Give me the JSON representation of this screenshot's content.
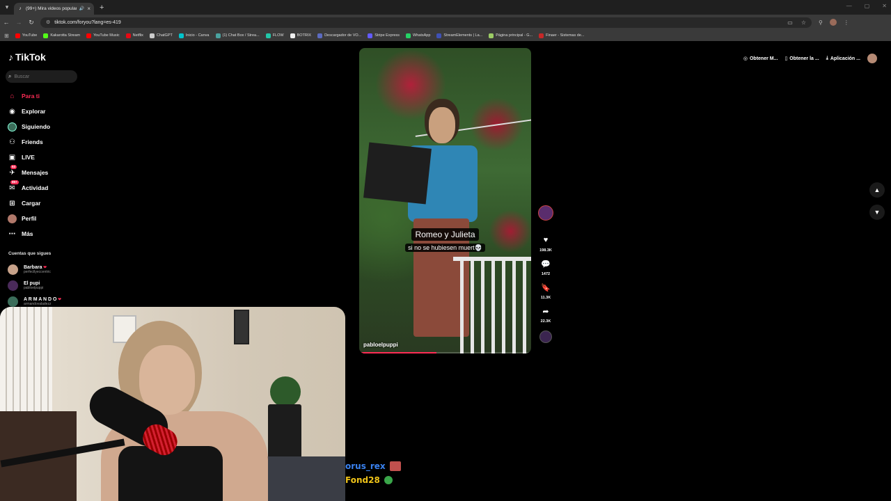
{
  "browser": {
    "tab_title": "(99+) Mira videos populares",
    "url": "tiktok.com/foryou?lang=es-419",
    "bookmarks": [
      {
        "label": "YouTube",
        "color": "#ff0000"
      },
      {
        "label": "Kakarotta Stream",
        "color": "#53fc18"
      },
      {
        "label": "YouTube Music",
        "color": "#ff0000"
      },
      {
        "label": "Netflix",
        "color": "#e50914"
      },
      {
        "label": "ChatGPT",
        "color": "#cccccc"
      },
      {
        "label": "Inicio - Canva",
        "color": "#00c4cc"
      },
      {
        "label": "(1) Chat Box / Strea...",
        "color": "#4aa3a0"
      },
      {
        "label": "FLOW",
        "color": "#22c7a9"
      },
      {
        "label": "BOTRIX",
        "color": "#eeeeee"
      },
      {
        "label": "Descargador de VO...",
        "color": "#5c6bc0"
      },
      {
        "label": "Stripe Express",
        "color": "#635bff"
      },
      {
        "label": "WhatsApp",
        "color": "#25d366"
      },
      {
        "label": "StreamElements | La...",
        "color": "#3f51b5"
      },
      {
        "label": "Página principal - G...",
        "color": "#9ccc65"
      },
      {
        "label": "Finaer - Sistemas de...",
        "color": "#c62828"
      }
    ]
  },
  "tiktok": {
    "logo": "TikTok",
    "search_placeholder": "Buscar",
    "nav": [
      {
        "label": "Para ti",
        "icon": "home-icon"
      },
      {
        "label": "Explorar",
        "icon": "compass-icon"
      },
      {
        "label": "Siguiendo",
        "icon": "following-avatar-icon"
      },
      {
        "label": "Friends",
        "icon": "friends-icon"
      },
      {
        "label": "LIVE",
        "icon": "live-icon"
      },
      {
        "label": "Mensajes",
        "icon": "messages-icon",
        "badge": "54"
      },
      {
        "label": "Actividad",
        "icon": "activity-icon",
        "badge": "99+"
      },
      {
        "label": "Cargar",
        "icon": "upload-icon"
      },
      {
        "label": "Perfil",
        "icon": "profile-icon"
      },
      {
        "label": "Más",
        "icon": "more-icon"
      }
    ],
    "following_title": "Cuentas que sigues",
    "following": [
      {
        "name": "Barbara",
        "user": "perfectlyeccentric",
        "color": "#c7a28a"
      },
      {
        "name": "El pupi",
        "user": "pabloelpuppi",
        "color": "#4a2a5a"
      },
      {
        "name": "A R M A N D O",
        "user": "armandovaladezz",
        "color": "#3b6d5a"
      }
    ],
    "top_actions": [
      "Obtener M...",
      "Obtener la ...",
      "Aplicación ..."
    ],
    "video": {
      "caption_title": "Romeo y Julieta",
      "caption_sub": "si no se hubiesen muert💀",
      "author": "pabloelpuppi",
      "progress": 0.45,
      "likes": "198.3K",
      "comments": "1472",
      "saves": "11.3K",
      "shares": "22.3K"
    }
  },
  "chat": [
    {
      "name": "orus_rex"
    },
    {
      "name": "Fond28"
    }
  ]
}
